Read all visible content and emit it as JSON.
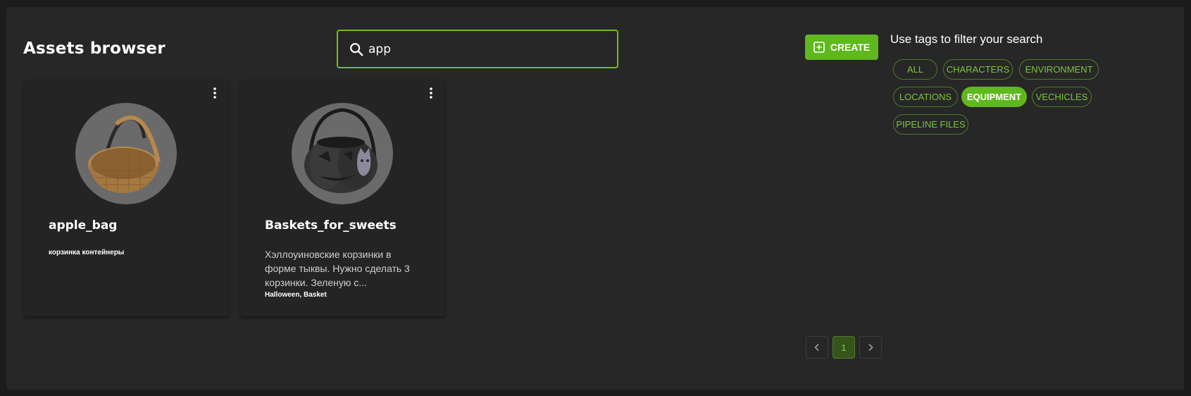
{
  "header": {
    "title": "Assets browser"
  },
  "search": {
    "value": "app",
    "icon": "search-icon"
  },
  "create_button": {
    "label": "CREATE",
    "icon": "plus-square-icon"
  },
  "tags_panel": {
    "title": "Use tags to filter your search",
    "tags": [
      {
        "label": "ALL",
        "active": false
      },
      {
        "label": "CHARACTERS",
        "active": false
      },
      {
        "label": "ENVIRONMENT",
        "active": false
      },
      {
        "label": "LOCATIONS",
        "active": false
      },
      {
        "label": "EQUIPMENT",
        "active": true
      },
      {
        "label": "VECHICLES",
        "active": false
      },
      {
        "label": "PIPELINE FILES",
        "active": false
      }
    ]
  },
  "cards": [
    {
      "name": "apple_bag",
      "description": "",
      "tags": "корзинка контейнеры",
      "thumbnail": "wicker-basket-image"
    },
    {
      "name": "Baskets_for_sweets",
      "description": "Хэллоуиновские корзинки в форме тыквы. Нужно сделать 3 корзинки. Зеленую с...",
      "tags": "Halloween, Basket",
      "thumbnail": "pumpkin-basket-image"
    }
  ],
  "pagination": {
    "prev_icon": "chevron-left-icon",
    "next_icon": "chevron-right-icon",
    "current_page": "1"
  },
  "colors": {
    "accent": "#5fb81d",
    "background": "#272727",
    "card": "#242424"
  }
}
